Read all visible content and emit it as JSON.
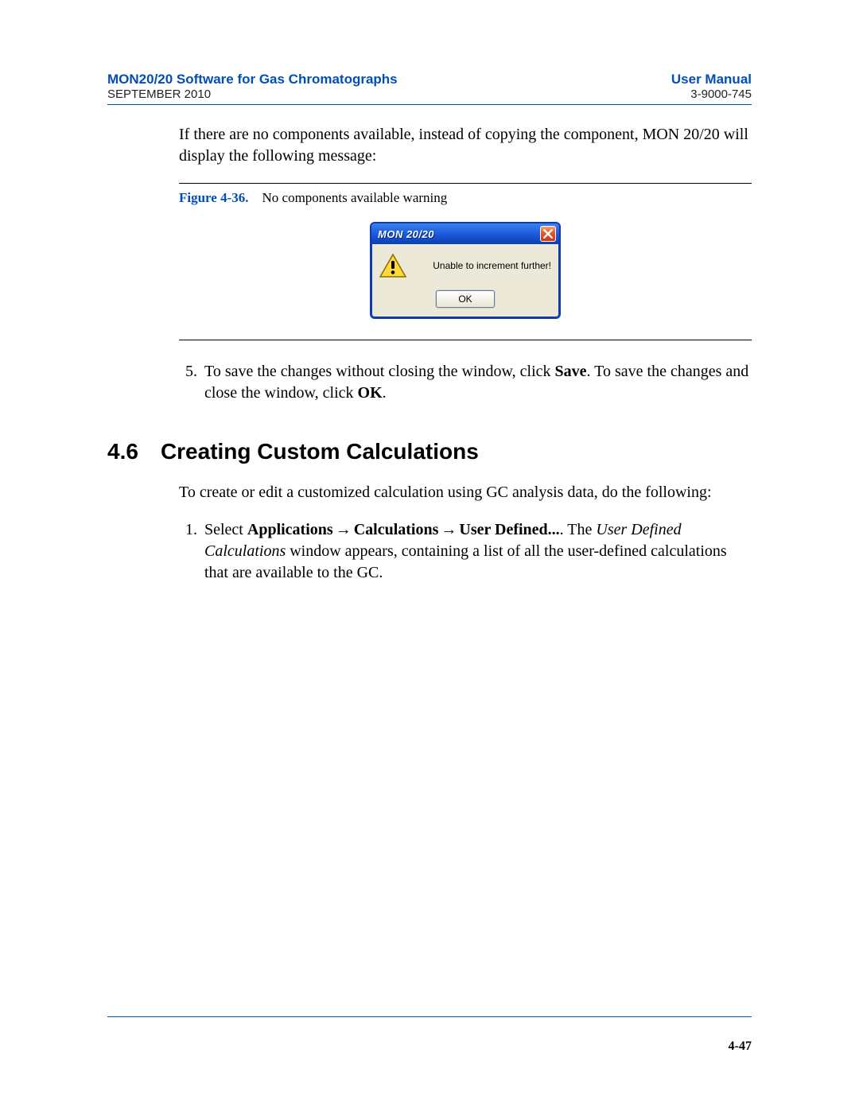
{
  "header": {
    "left_title": "MON20/20 Software for Gas Chromatographs",
    "left_sub": "SEPTEMBER 2010",
    "right_title": "User Manual",
    "right_sub": "3-9000-745"
  },
  "intro_paragraph": "If there are no components available, instead of copying the component, MON 20/20 will display the following message:",
  "figure": {
    "label": "Figure 4-36.",
    "caption": "No components available warning",
    "dialog": {
      "title": "MON 20/20",
      "message": "Unable to increment further!",
      "button": "OK"
    }
  },
  "step5": {
    "number": "5",
    "pre": "To save the changes without closing the window, click ",
    "save": "Save",
    "mid": ". To save the changes and close the window, click ",
    "ok": "OK",
    "post": "."
  },
  "section": {
    "number": "4.6",
    "title": "Creating Custom Calculations"
  },
  "section_intro": "To create or edit a customized calculation using GC analysis data, do the following:",
  "step1": {
    "number": "1",
    "select": "Select ",
    "applications": "Applications",
    "arrow": "→",
    "calculations": "Calculations",
    "user_defined": "User Defined...",
    "period": ".  The ",
    "udc_italic": "User Defined Calculations",
    "tail": " window appears, containing a list of all the user-defined calculations that are available to the GC."
  },
  "footer": {
    "page": "4-47"
  }
}
